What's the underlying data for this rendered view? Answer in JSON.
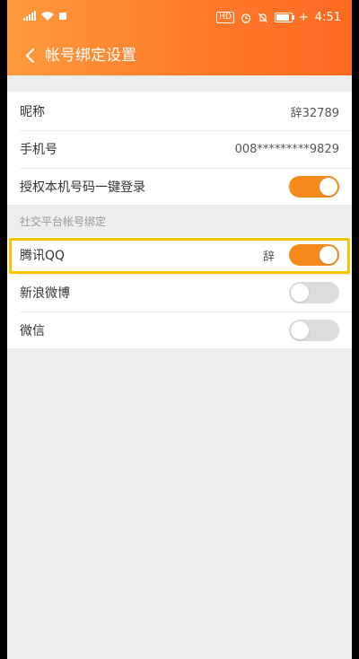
{
  "status_bar": {
    "time": "4:51",
    "battery_label": "+"
  },
  "header": {
    "title": "帐号绑定设置"
  },
  "account": {
    "nickname_label": "昵称",
    "nickname_value": "辞32789",
    "phone_label": "手机号",
    "phone_value": "008*********9829",
    "one_click_label": "授权本机号码一键登录",
    "one_click_enabled": true
  },
  "social": {
    "section_title": "社交平台帐号绑定",
    "items": [
      {
        "label": "腾讯QQ",
        "value": "辞",
        "enabled": true
      },
      {
        "label": "新浪微博",
        "value": "",
        "enabled": false
      },
      {
        "label": "微信",
        "value": "",
        "enabled": false
      }
    ]
  },
  "colors": {
    "accent": "#f78a1d",
    "header_gradient_start": "#ff9a3c",
    "header_gradient_end": "#ff6a22",
    "highlight": "#ffc400"
  }
}
